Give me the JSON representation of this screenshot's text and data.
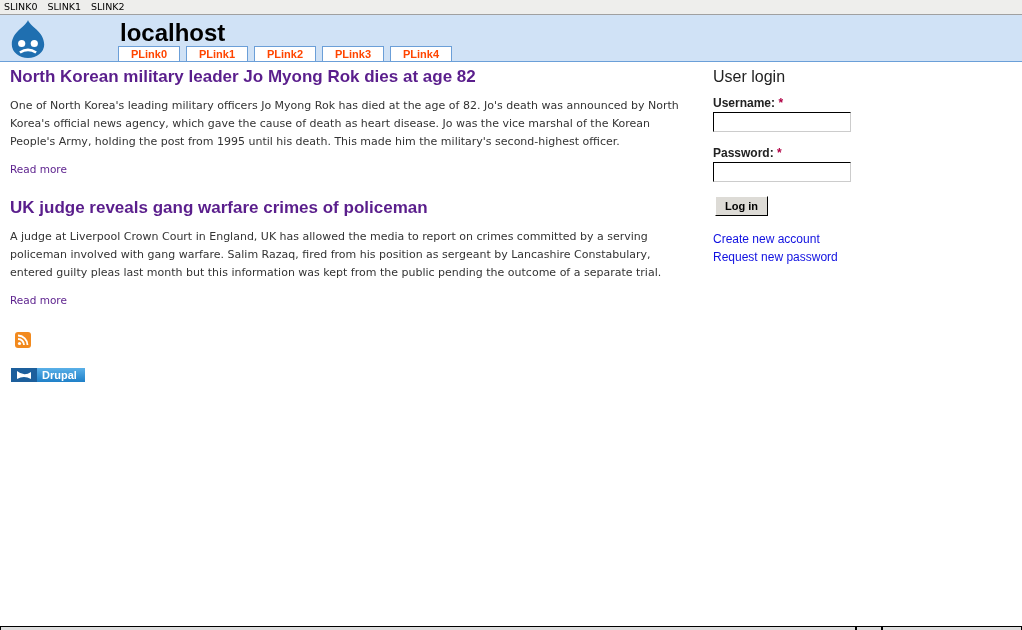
{
  "top_links": [
    "SLINK0",
    "SLINK1",
    "SLINK2"
  ],
  "site": {
    "name": "localhost"
  },
  "tabs": [
    {
      "label": "PLink0",
      "selected": false
    },
    {
      "label": "PLink1",
      "selected": false
    },
    {
      "label": "PLink2",
      "selected": false
    },
    {
      "label": "PLink3",
      "selected": false
    },
    {
      "label": "PLink4",
      "selected": false
    }
  ],
  "articles": [
    {
      "title": "North Korean military leader Jo Myong Rok dies at age 82",
      "body": "One of North Korea's leading military officers Jo Myong Rok has died at the age of 82. Jo's death was announced by North Korea's official news agency, which gave the cause of death as heart disease. Jo was the vice marshal of the Korean People's Army, holding the post from 1995 until his death. This made him the military's second-highest officer.",
      "link": "Read more"
    },
    {
      "title": "UK judge reveals gang warfare crimes of policeman",
      "body": "A judge at Liverpool Crown Court in England, UK has allowed the media to report on crimes committed by a serving policeman involved with gang warfare. Salim Razaq, fired from his position as sergeant by Lancashire Constabulary, entered guilty pleas last month but this information was kept from the public pending the outcome of a separate trial.",
      "link": "Read more"
    }
  ],
  "powered_by": {
    "label": "Drupal"
  },
  "login": {
    "title": "User login",
    "fields": [
      {
        "label": "Username:",
        "required_mark": "*"
      },
      {
        "label": "Password:",
        "required_mark": "*"
      }
    ],
    "button": "Log in",
    "links": [
      "Create new account",
      "Request new password"
    ]
  }
}
